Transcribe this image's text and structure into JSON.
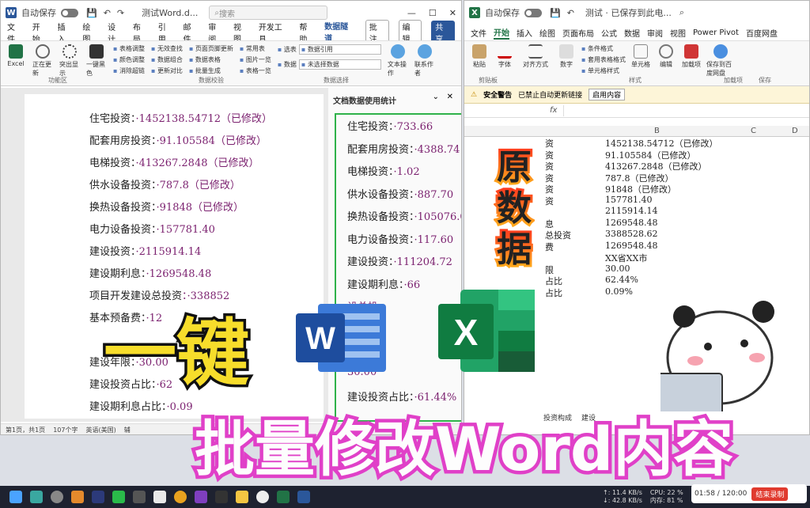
{
  "word": {
    "autosave": "自动保存",
    "title": "测试Word.d...",
    "search_placeholder": "搜索",
    "menu": [
      "文件",
      "开始",
      "插入",
      "绘图",
      "设计",
      "布局",
      "引用",
      "邮件",
      "审阅",
      "视图",
      "开发工具",
      "帮助",
      "数据隧道"
    ],
    "active_menu": "数据隧道",
    "comment_btn": "批注",
    "edit_btn": "编辑",
    "share_btn": "共享",
    "ribbon": {
      "btn_excel": "Excel",
      "btn_update": "正在更新",
      "btn_highlight": "突出显示",
      "btn_color": "一键黑色",
      "list1": [
        "表格调整",
        "颜色调整",
        "消除超链"
      ],
      "list2": [
        "无效查找",
        "数据组合",
        "更新对比"
      ],
      "list3": [
        "页面页脚更新",
        "数据表格",
        "批量生成"
      ],
      "list4": [
        "常用表",
        "图片一览",
        "表格一览"
      ],
      "source_label": "选表",
      "source_value": "数据引用",
      "data_label": "数据",
      "data_value": "未选择数据",
      "btn_text_op": "文本操作",
      "btn_contact": "联系作者",
      "group_func": "功能区",
      "group_verify": "数据校验",
      "group_select": "数据选择"
    },
    "lines": [
      {
        "label": "住宅投资：",
        "value": "·1452138.54712（已修改）"
      },
      {
        "label": "配套用房投资：",
        "value": "·91.105584（已修改）"
      },
      {
        "label": "电梯投资：",
        "value": "·413267.2848（已修改）"
      },
      {
        "label": "供水设备投资：",
        "value": "·787.8（已修改）"
      },
      {
        "label": "换热设备投资：",
        "value": "·91848（已修改）"
      },
      {
        "label": "电力设备投资：",
        "value": "·157781.40"
      },
      {
        "label": "建设投资：",
        "value": "·2115914.14"
      },
      {
        "label": "建设期利息：",
        "value": "·1269548.48"
      },
      {
        "label": "项目开发建设总投资",
        "value": "：·338852"
      },
      {
        "label": "基本预备费：",
        "value": "·12"
      },
      {
        "label": "",
        "value": ""
      },
      {
        "label": "建设年限：",
        "value": "·30.00"
      },
      {
        "label": "建设投资占比：",
        "value": "·62"
      },
      {
        "label": "建设期利息占比：",
        "value": "·0.09"
      }
    ],
    "pane_title": "文档数据使用统计",
    "pane_lines": [
      {
        "label": "住宅投资：",
        "value": "·733.66"
      },
      {
        "label": "配套用房投资：",
        "value": "·4388.74"
      },
      {
        "label": "电梯投资：",
        "value": "·1.02"
      },
      {
        "label": "供水设备投资：",
        "value": "·887.70"
      },
      {
        "label": "换热设备投资：",
        "value": "·105076.00"
      },
      {
        "label": "电力设备投资：",
        "value": "·117.60"
      },
      {
        "label": "建设投资：",
        "value": "·111204.72"
      },
      {
        "label": "建设期利息：",
        "value": "·66"
      },
      {
        "label": "",
        "value": "设总投"
      },
      {
        "label": "",
        "value": "·66"
      },
      {
        "label": "",
        "value": "天南"
      },
      {
        "label": "",
        "value": "30.00"
      },
      {
        "label": "建设投资占比：",
        "value": "·61.44%"
      }
    ],
    "status": [
      "第1页，共1页",
      "107个字",
      "英语(美国)",
      "辅"
    ]
  },
  "excel": {
    "autosave": "自动保存",
    "title": "测试 · 已保存到此电...",
    "menu": [
      "文件",
      "开始",
      "插入",
      "绘图",
      "页面布局",
      "公式",
      "数据",
      "审阅",
      "视图",
      "Power Pivot",
      "百度网盘"
    ],
    "active_menu": "开始",
    "ribbon": {
      "paste": "粘贴",
      "font": "字体",
      "align": "对齐方式",
      "number": "数字",
      "cond": "条件格式",
      "table": "套用表格格式",
      "cellstyle": "单元格样式",
      "cells": "单元格",
      "edit": "编辑",
      "addins": "加载项",
      "save_baidu": "保存到百度网盘",
      "group_clip": "剪贴板",
      "group_style": "样式",
      "group_addins": "加载项",
      "group_save": "保存"
    },
    "warning_label": "安全警告",
    "warning_text": "已禁止自动更新链接",
    "warning_btn": "启用内容",
    "fx": "fx",
    "columns": [
      "B",
      "C",
      "D"
    ],
    "col_a": [
      "资",
      "资",
      "资",
      "资",
      "资",
      "资",
      "",
      "息",
      "总投资",
      "费",
      "",
      "限",
      "占比",
      "占比"
    ],
    "col_b": [
      "1452138.54712（已修改）",
      "91.105584（已修改）",
      "413267.2848（已修改）",
      "787.8（已修改）",
      "91848（已修改）",
      "157781.40",
      "2115914.14",
      "1269548.48",
      "3388528.62",
      "1269548.48",
      "XX省XX市",
      "30.00",
      "62.44%",
      "0.09%"
    ],
    "sheet_tabs": [
      "投资构成",
      "建设"
    ]
  },
  "overlay": {
    "yijian": "一键",
    "yuan": "原",
    "shu": "数",
    "ju": "据",
    "bottom_banner": "批量修改Word内容"
  },
  "taskbar": {
    "net_up": "↑: 11.4 KB/s",
    "net_down": "↓: 42.8 KB/s",
    "cpu": "CPU: 22 %",
    "mem": "内存: 81 %",
    "timer": "01:58 / 120:00",
    "stop_btn": "结束录制"
  },
  "colors": {
    "word_blue": "#2b579a",
    "excel_green": "#217346",
    "banner_pink": "#e040c8"
  }
}
